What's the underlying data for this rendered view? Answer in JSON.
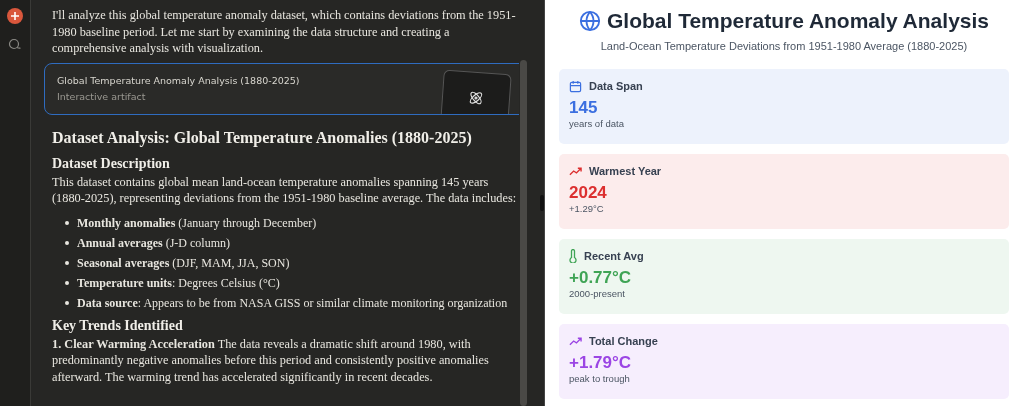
{
  "chat": {
    "intro": "I'll analyze this global temperature anomaly dataset, which contains deviations from the 1951-1980 baseline period. Let me start by examining the data structure and creating a comprehensive analysis with visualization.",
    "artifact": {
      "title": "Global Temperature Anomaly Analysis (1880-2025)",
      "subtitle": "Interactive artifact"
    },
    "heading": "Dataset Analysis: Global Temperature Anomalies (1880-2025)",
    "section_1": {
      "title": "Dataset Description",
      "text": "This dataset contains global mean land-ocean temperature anomalies spanning 145 years (1880-2025), representing deviations from the 1951-1980 baseline average. The data includes:",
      "items": [
        "**Monthly anomalies** (January through December)",
        "**Annual averages** (J-D column)",
        "**Seasonal averages** (DJF, MAM, JJA, SON)",
        "**Temperature units**: Degrees Celsius (°C)",
        "**Data source**: Appears to be from NASA GISS or similar climate monitoring organization"
      ]
    },
    "section_2": {
      "title": "Key Trends Identified",
      "text": "**1. Clear Warming Acceleration** The data reveals a dramatic shift around 1980, with predominantly negative anomalies before this period and consistently positive anomalies afterward. The warming trend has accelerated significantly in recent decades."
    }
  },
  "artifact_view": {
    "title": "Global Temperature Anomaly Analysis",
    "subtitle": "Land-Ocean Temperature Deviations from 1951-1980 Average (1880-2025)",
    "cards": [
      {
        "kind": "calendar",
        "label": "Data Span",
        "value": "145",
        "note": "years of data",
        "color": "#3b6fe0"
      },
      {
        "kind": "trend",
        "label": "Warmest Year",
        "value": "2024",
        "note": "+1.29°C",
        "color": "#dc2f2f"
      },
      {
        "kind": "thermometer",
        "label": "Recent Avg",
        "value": "+0.77°C",
        "note": "2000-present",
        "color": "#3fa455"
      },
      {
        "kind": "trend",
        "label": "Total Change",
        "value": "+1.79°C",
        "note": "peak to trough",
        "color": "#9b45e4"
      }
    ]
  }
}
